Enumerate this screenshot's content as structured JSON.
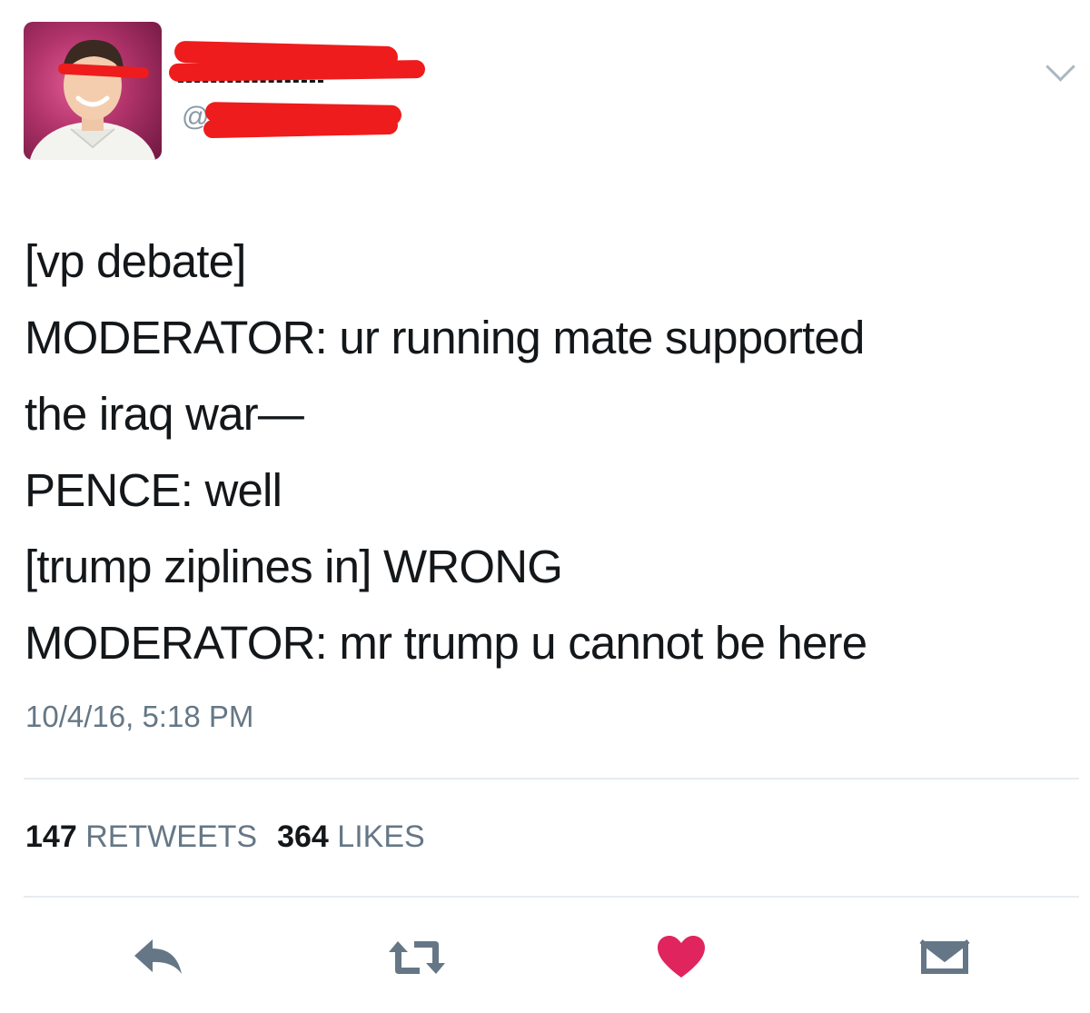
{
  "colors": {
    "text": "#14171a",
    "muted": "#657786",
    "divider": "#e6ecf0",
    "like": "#e0245e",
    "icon": "#657786",
    "redaction": "#ee1c1c"
  },
  "header": {
    "handle_prefix": "@"
  },
  "tweet": {
    "lines": [
      "[vp debate]",
      "MODERATOR: ur running mate supported",
      "the iraq war—",
      "PENCE: well",
      "[trump ziplines in] WRONG",
      "MODERATOR: mr trump u cannot be here"
    ],
    "timestamp": "10/4/16, 5:18 PM"
  },
  "stats": {
    "retweets_count": "147",
    "retweets_label": "RETWEETS",
    "likes_count": "364",
    "likes_label": "LIKES"
  },
  "actions": {
    "icons": [
      "reply-icon",
      "retweet-icon",
      "like-heart-icon",
      "direct-message-icon"
    ],
    "liked": true
  }
}
